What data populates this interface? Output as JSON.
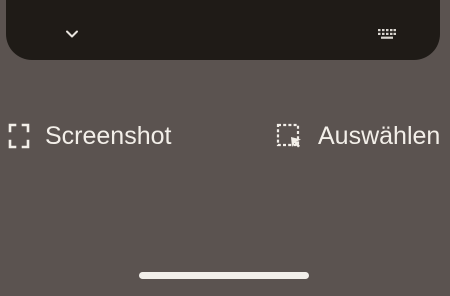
{
  "actions": {
    "screenshot_label": "Screenshot",
    "select_label": "Auswählen"
  },
  "icons": {
    "collapse": "chevron-down-icon",
    "keyboard": "keyboard-icon",
    "screenshot": "screenshot-frame-icon",
    "select": "select-area-icon"
  },
  "colors": {
    "background": "#5b5350",
    "top_panel": "#1f1b17",
    "text": "#f3efe9"
  }
}
